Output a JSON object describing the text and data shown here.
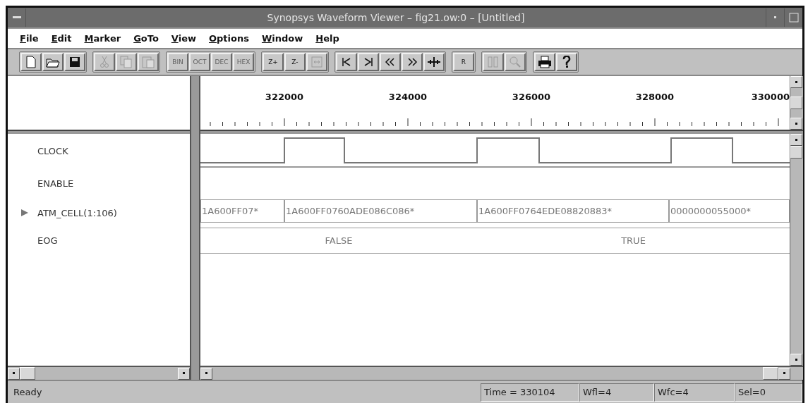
{
  "window": {
    "title": "Synopsys Waveform Viewer – fig21.ow:0 – [Untitled]"
  },
  "menu": [
    "File",
    "Edit",
    "Marker",
    "GoTo",
    "View",
    "Options",
    "Window",
    "Help"
  ],
  "toolbar": [
    {
      "buttons": [
        {
          "disabled": false
        },
        {
          "disabled": false
        },
        {
          "disabled": false
        }
      ]
    },
    {
      "buttons": [
        {
          "disabled": true
        },
        {
          "disabled": true
        },
        {
          "disabled": true
        }
      ]
    },
    {
      "buttons": [
        {
          "label": "BIN",
          "disabled": true
        },
        {
          "label": "OCT",
          "disabled": true
        },
        {
          "label": "DEC",
          "disabled": true
        },
        {
          "label": "HEX",
          "disabled": true
        }
      ]
    },
    {
      "buttons": [
        {
          "label": "Z+",
          "disabled": false
        },
        {
          "label": "Z-",
          "disabled": false
        },
        {
          "disabled": true
        }
      ]
    },
    {
      "buttons": [
        {
          "disabled": false
        },
        {
          "disabled": false
        },
        {
          "disabled": false
        },
        {
          "disabled": false
        },
        {
          "disabled": false
        }
      ]
    },
    {
      "buttons": [
        {
          "label": "R",
          "disabled": false
        }
      ]
    },
    {
      "buttons": [
        {
          "disabled": true
        },
        {
          "disabled": true
        }
      ]
    },
    {
      "buttons": [
        {
          "disabled": false
        },
        {
          "disabled": false
        }
      ]
    }
  ],
  "ruler": [
    "322000",
    "324000",
    "326000",
    "328000",
    "330000"
  ],
  "signals": [
    {
      "name": "CLOCK",
      "kind": "clock"
    },
    {
      "name": "ENABLE",
      "kind": "plain"
    },
    {
      "name": "ATM_CELL(1:106)",
      "kind": "bus",
      "expanded": false,
      "values": [
        "1A600FF07*",
        "1A600FF0760ADE086C086*",
        "1A600FF0764EDE08820883*",
        "0000000055000*"
      ]
    },
    {
      "name": "EOG",
      "kind": "enum",
      "values": [
        "FALSE",
        "TRUE"
      ]
    }
  ],
  "status_bar": {
    "message": "Ready",
    "fields": [
      "Time = 330104",
      "Wfl=4",
      "Wfc=4",
      "Sel=0"
    ]
  }
}
